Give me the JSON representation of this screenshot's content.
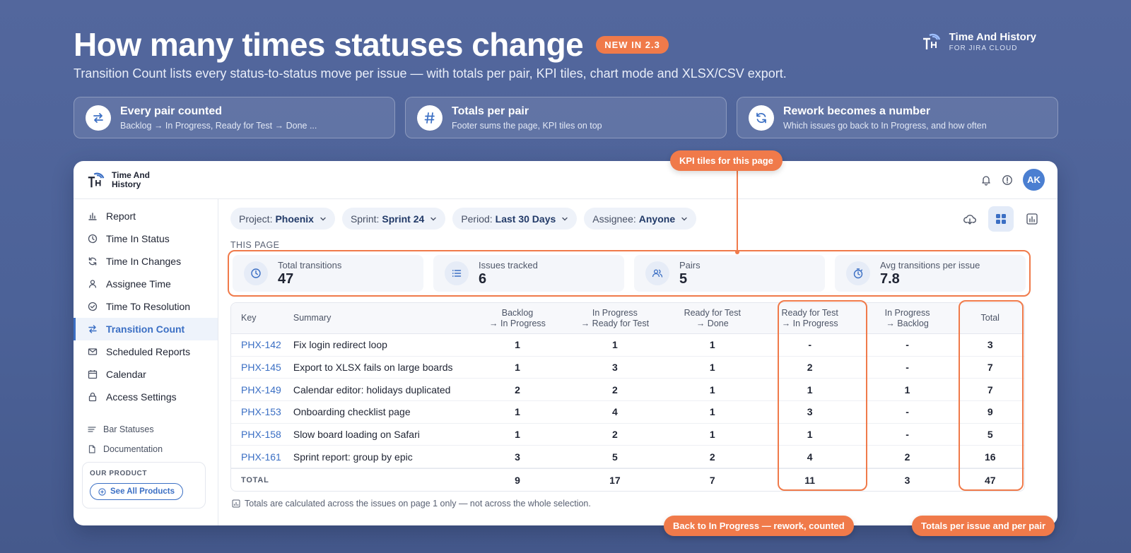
{
  "hero": {
    "title": "How many times statuses change",
    "badge": "NEW IN 2.3",
    "subtitle": "Transition Count lists every status-to-status move per issue — with totals per pair, KPI tiles, chart mode and XLSX/CSV export."
  },
  "brand": {
    "name": "Time And History",
    "tagline": "FOR JIRA CLOUD",
    "app_name_line1": "Time And",
    "app_name_line2": "History",
    "avatar": "AK"
  },
  "features": [
    {
      "icon": "swap-arrows-icon",
      "title": "Every pair counted",
      "desc": "Backlog → In Progress, Ready for Test → Done ..."
    },
    {
      "icon": "hash-icon",
      "title": "Totals per pair",
      "desc": "Footer sums the page, KPI tiles on top"
    },
    {
      "icon": "refresh-icon",
      "title": "Rework becomes a number",
      "desc": "Which issues go back to In Progress, and how often"
    }
  ],
  "sidebar": {
    "items": [
      {
        "label": "Report",
        "icon": "bar-chart-icon"
      },
      {
        "label": "Time In Status",
        "icon": "clock-icon"
      },
      {
        "label": "Time In Changes",
        "icon": "refresh-icon"
      },
      {
        "label": "Assignee Time",
        "icon": "user-icon"
      },
      {
        "label": "Time To Resolution",
        "icon": "check-circle-icon"
      },
      {
        "label": "Transition Count",
        "icon": "swap-arrows-icon",
        "active": true
      },
      {
        "label": "Scheduled Reports",
        "icon": "mail-icon"
      },
      {
        "label": "Calendar",
        "icon": "calendar-icon"
      },
      {
        "label": "Access Settings",
        "icon": "lock-icon"
      }
    ],
    "sub_items": [
      {
        "label": "Bar Statuses",
        "icon": "lines-icon"
      },
      {
        "label": "Documentation",
        "icon": "document-icon"
      }
    ],
    "our_product": {
      "title": "OUR PRODUCT",
      "button": "See All Products"
    }
  },
  "filters": [
    {
      "prefix": "Project:",
      "value": "Phoenix"
    },
    {
      "prefix": "Sprint:",
      "value": "Sprint 24"
    },
    {
      "prefix": "Period:",
      "value": "Last 30 Days"
    },
    {
      "prefix": "Assignee:",
      "value": "Anyone"
    }
  ],
  "this_page_label": "THIS PAGE",
  "kpis": [
    {
      "label": "Total transitions",
      "value": "47",
      "icon": "clock-icon"
    },
    {
      "label": "Issues tracked",
      "value": "6",
      "icon": "list-icon"
    },
    {
      "label": "Pairs",
      "value": "5",
      "icon": "users-icon"
    },
    {
      "label": "Avg transitions per issue",
      "value": "7.8",
      "icon": "stopwatch-icon"
    }
  ],
  "table": {
    "columns": {
      "key": "Key",
      "summary": "Summary",
      "p1": [
        "Backlog",
        "→ In Progress"
      ],
      "p2": [
        "In Progress",
        "→ Ready for Test"
      ],
      "p3": [
        "Ready for Test",
        "→ Done"
      ],
      "p4": [
        "Ready for Test",
        "→ In Progress"
      ],
      "p5": [
        "In Progress",
        "→ Backlog"
      ],
      "total": "Total"
    },
    "rows": [
      {
        "key": "PHX-142",
        "summary": "Fix login redirect loop",
        "p1": "1",
        "p2": "1",
        "p3": "1",
        "p4": "-",
        "p5": "-",
        "total": "3"
      },
      {
        "key": "PHX-145",
        "summary": "Export to XLSX fails on large boards",
        "p1": "1",
        "p2": "3",
        "p3": "1",
        "p4": "2",
        "p5": "-",
        "total": "7"
      },
      {
        "key": "PHX-149",
        "summary": "Calendar editor: holidays duplicated",
        "p1": "2",
        "p2": "2",
        "p3": "1",
        "p4": "1",
        "p5": "1",
        "total": "7"
      },
      {
        "key": "PHX-153",
        "summary": "Onboarding checklist page",
        "p1": "1",
        "p2": "4",
        "p3": "1",
        "p4": "3",
        "p5": "-",
        "total": "9"
      },
      {
        "key": "PHX-158",
        "summary": "Slow board loading on Safari",
        "p1": "1",
        "p2": "2",
        "p3": "1",
        "p4": "1",
        "p5": "-",
        "total": "5"
      },
      {
        "key": "PHX-161",
        "summary": "Sprint report: group by epic",
        "p1": "3",
        "p2": "5",
        "p3": "2",
        "p4": "4",
        "p5": "2",
        "total": "16"
      }
    ],
    "totals": {
      "label": "TOTAL",
      "p1": "9",
      "p2": "17",
      "p3": "7",
      "p4": "11",
      "p5": "3",
      "total": "47"
    }
  },
  "footnote": "Totals are calculated across the issues on page 1 only — not across the whole selection.",
  "callouts": {
    "kpi": "KPI tiles for this page",
    "rework": "Back to In Progress — rework, counted",
    "totals": "Totals per issue and per pair"
  },
  "colors": {
    "accent": "#f07a4a",
    "primary": "#3b6fc4",
    "background": "#4c6298"
  }
}
